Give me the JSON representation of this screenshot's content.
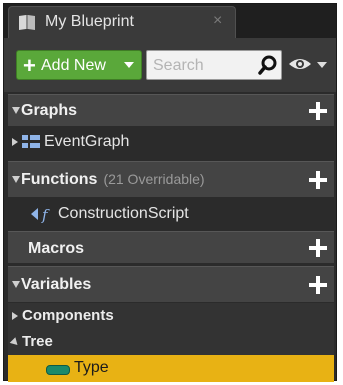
{
  "tab": {
    "title": "My Blueprint",
    "close": "×"
  },
  "toolbar": {
    "add_new_label": "Add New",
    "search_placeholder": "Search"
  },
  "sections": {
    "graphs": {
      "title": "Graphs"
    },
    "functions": {
      "title": "Functions",
      "subtitle": "(21 Overridable)"
    },
    "macros": {
      "title": "Macros"
    },
    "variables": {
      "title": "Variables"
    }
  },
  "items": {
    "event_graph": "EventGraph",
    "construction_script": "ConstructionScript",
    "components": "Components",
    "tree": "Tree",
    "type": "Type"
  },
  "colors": {
    "add_button": "#5aa83a",
    "selected_row": "#e8b214",
    "variable_pill": "#1b8a6b"
  }
}
